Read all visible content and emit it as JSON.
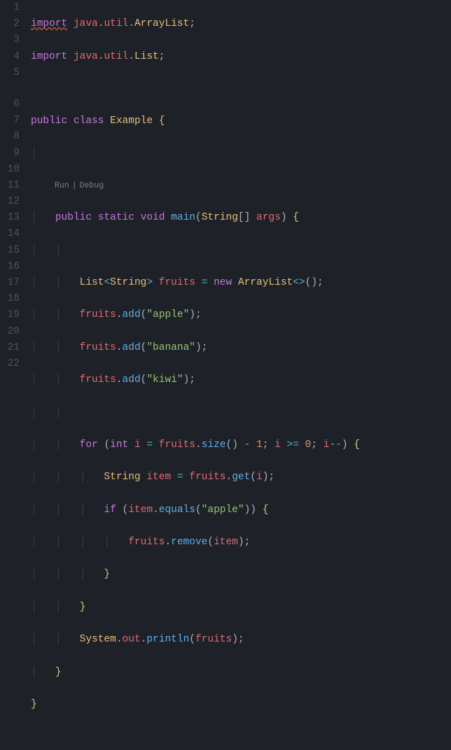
{
  "codelens": {
    "run": "Run",
    "sep": "|",
    "debug": "Debug"
  },
  "lineNumbers": [
    "1",
    "2",
    "3",
    "4",
    "5",
    "6",
    "7",
    "8",
    "9",
    "10",
    "11",
    "12",
    "13",
    "14",
    "15",
    "16",
    "17",
    "18",
    "19",
    "20",
    "21",
    "22"
  ],
  "tokens": {
    "import": "import",
    "public": "public",
    "class": "class",
    "static": "static",
    "void": "void",
    "new": "new",
    "for": "for",
    "int": "int",
    "if": "if",
    "java": "java",
    "util": "util",
    "ArrayList": "ArrayList",
    "List": "List",
    "Example": "Example",
    "main": "main",
    "String": "String",
    "args": "args",
    "fruits": "fruits",
    "add": "add",
    "size": "size",
    "get": "get",
    "equals": "equals",
    "remove": "remove",
    "item": "item",
    "System": "System",
    "out": "out",
    "println": "println",
    "i": "i"
  },
  "strings": {
    "apple": "\"apple\"",
    "banana": "\"banana\"",
    "kiwi": "\"kiwi\""
  },
  "nums": {
    "one": "1",
    "zero": "0"
  },
  "source_lines": [
    "import java.util.ArrayList;",
    "import java.util.List;",
    "",
    "public class Example {",
    "",
    "    public static void main(String[] args) {",
    "",
    "        List<String> fruits = new ArrayList<>();",
    "        fruits.add(\"apple\");",
    "        fruits.add(\"banana\");",
    "        fruits.add(\"kiwi\");",
    "",
    "        for (int i = fruits.size() - 1; i >= 0; i--) {",
    "            String item = fruits.get(i);",
    "            if (item.equals(\"apple\")) {",
    "                fruits.remove(item);",
    "            }",
    "        }",
    "        System.out.println(fruits);",
    "    }",
    "}",
    ""
  ]
}
